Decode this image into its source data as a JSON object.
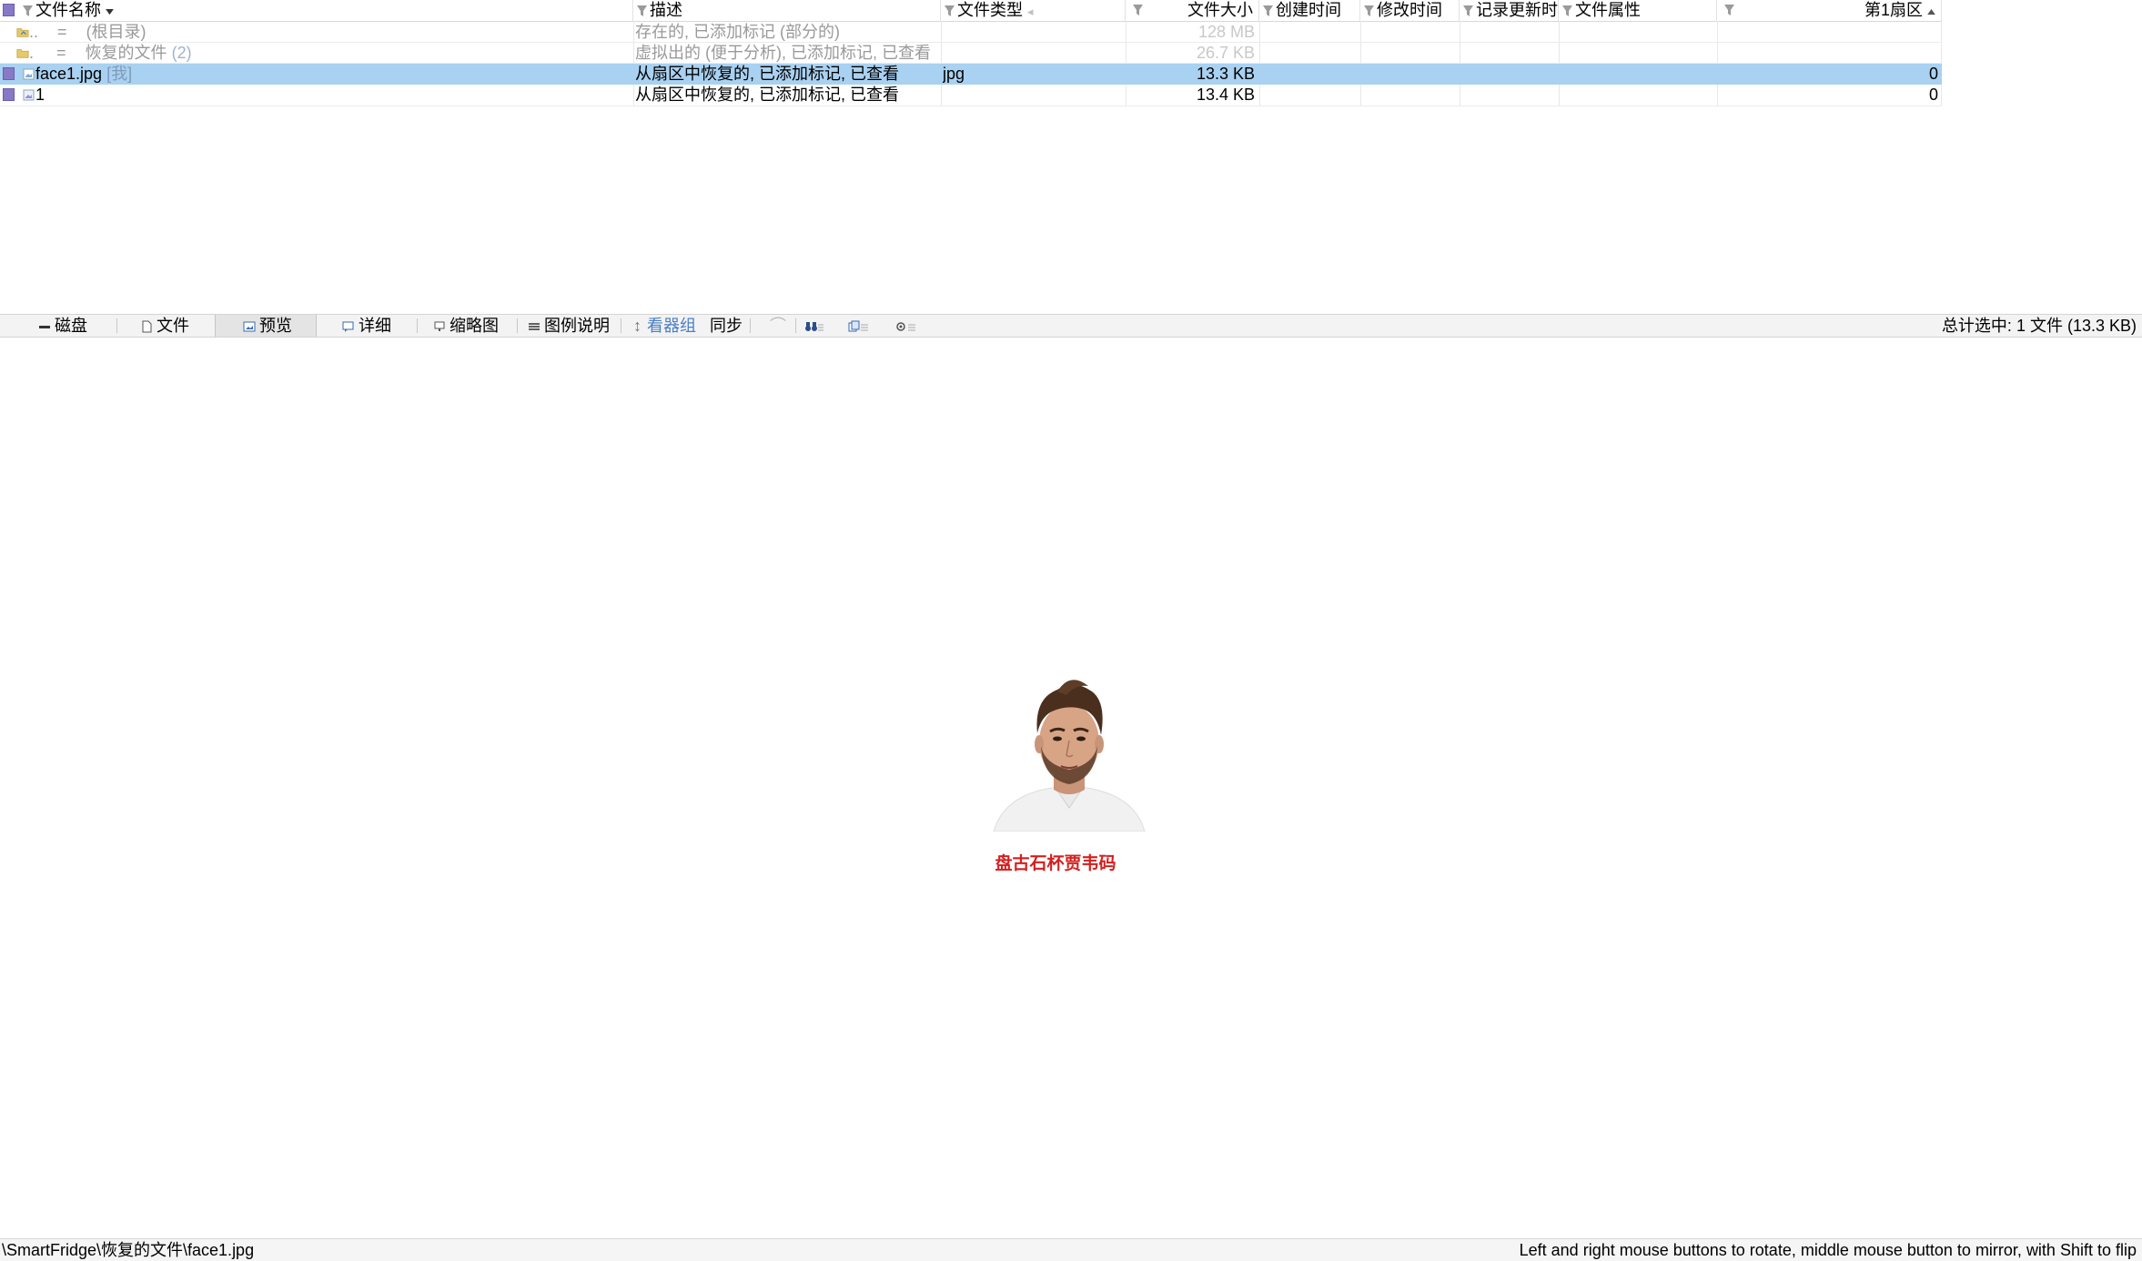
{
  "columns": {
    "name": "文件名称",
    "desc": "描述",
    "type": "文件类型",
    "size": "文件大小",
    "created": "创建时间",
    "modified": "修改时间",
    "record_updated": "记录更新时",
    "attributes": "文件属性",
    "first_sector": "第1扇区"
  },
  "rows": [
    {
      "name": "..",
      "eq": "=",
      "name_extra": "(根目录)",
      "desc": "存在的, 已添加标记 (部分的)",
      "type": "",
      "size": "128 MB",
      "sector": ""
    },
    {
      "name": ".",
      "eq": "=",
      "name_extra": "恢复的文件",
      "count": "(2)",
      "desc": "虚拟出的 (便于分析), 已添加标记, 已查看",
      "type": "",
      "size": "26.7 KB",
      "sector": ""
    },
    {
      "name": "face1.jpg",
      "tag": "[我]",
      "desc": "从扇区中恢复的, 已添加标记, 已查看",
      "type": "jpg",
      "size": "13.3 KB",
      "sector": "0"
    },
    {
      "name": "1",
      "desc": "从扇区中恢复的, 已添加标记, 已查看",
      "type": "",
      "size": "13.4 KB",
      "sector": "0"
    }
  ],
  "tabs": {
    "disk": "磁盘",
    "file": "文件",
    "preview": "预览",
    "details": "详细",
    "thumbs": "缩略图",
    "legend": "图例说明",
    "viewer": "看器组",
    "sync": "同步"
  },
  "status_total": "总计选中: 1 文件 (13.3 KB)",
  "preview": {
    "caption": "盘古石杯贾韦码"
  },
  "statusbar": {
    "path": "\\SmartFridge\\恢复的文件\\face1.jpg",
    "hint": "Left and right mouse buttons to rotate, middle mouse button to mirror, with Shift to flip"
  },
  "colors": {
    "selection": "#a9d1f1",
    "marker": "#8878c8",
    "caption_red": "#d42020",
    "dim_text": "#9a9a9a"
  }
}
